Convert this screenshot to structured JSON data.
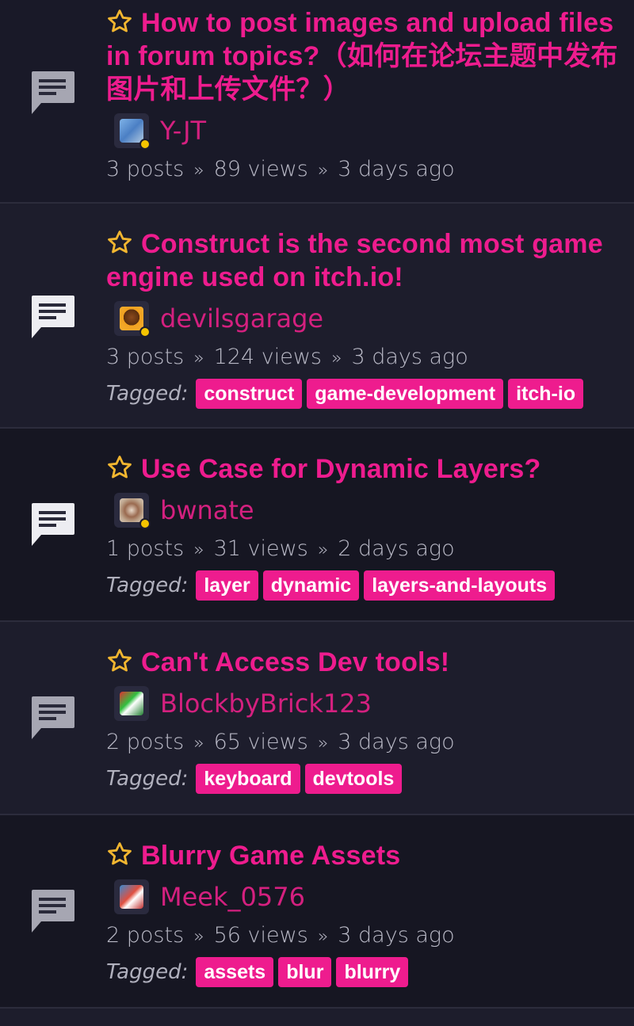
{
  "topics": [
    {
      "title": "How to post images and upload files in forum topics?（如何在论坛主题中发布图片和上传文件？）",
      "author": "Y-JT",
      "posts": "3 posts",
      "views": "89 views",
      "age": "3 days ago",
      "online": true,
      "tags": []
    },
    {
      "title": "Construct is the second most game engine used on itch.io!",
      "author": "devilsgarage",
      "posts": "3 posts",
      "views": "124 views",
      "age": "3 days ago",
      "online": true,
      "tags": [
        "construct",
        "game-development",
        "itch-io"
      ]
    },
    {
      "title": "Use Case for Dynamic Layers?",
      "author": "bwnate",
      "posts": "1 posts",
      "views": "31 views",
      "age": "2 days ago",
      "online": true,
      "tags": [
        "layer",
        "dynamic",
        "layers-and-layouts"
      ]
    },
    {
      "title": "Can't Access Dev tools!",
      "author": "BlockbyBrick123",
      "posts": "2 posts",
      "views": "65 views",
      "age": "3 days ago",
      "online": false,
      "tags": [
        "keyboard",
        "devtools"
      ]
    },
    {
      "title": "Blurry Game Assets",
      "author": "Meek_0576",
      "posts": "2 posts",
      "views": "56 views",
      "age": "3 days ago",
      "online": false,
      "tags": [
        "assets",
        "blur",
        "blurry"
      ]
    }
  ],
  "labels": {
    "tagged": "Tagged:",
    "separator": "»"
  },
  "colors": {
    "accent": "#ee1c8e",
    "star": "#f2b630",
    "online": "#f5c400"
  },
  "icons": {
    "topic": "chat-bubble-icon",
    "favorite": "star-outline-icon"
  }
}
